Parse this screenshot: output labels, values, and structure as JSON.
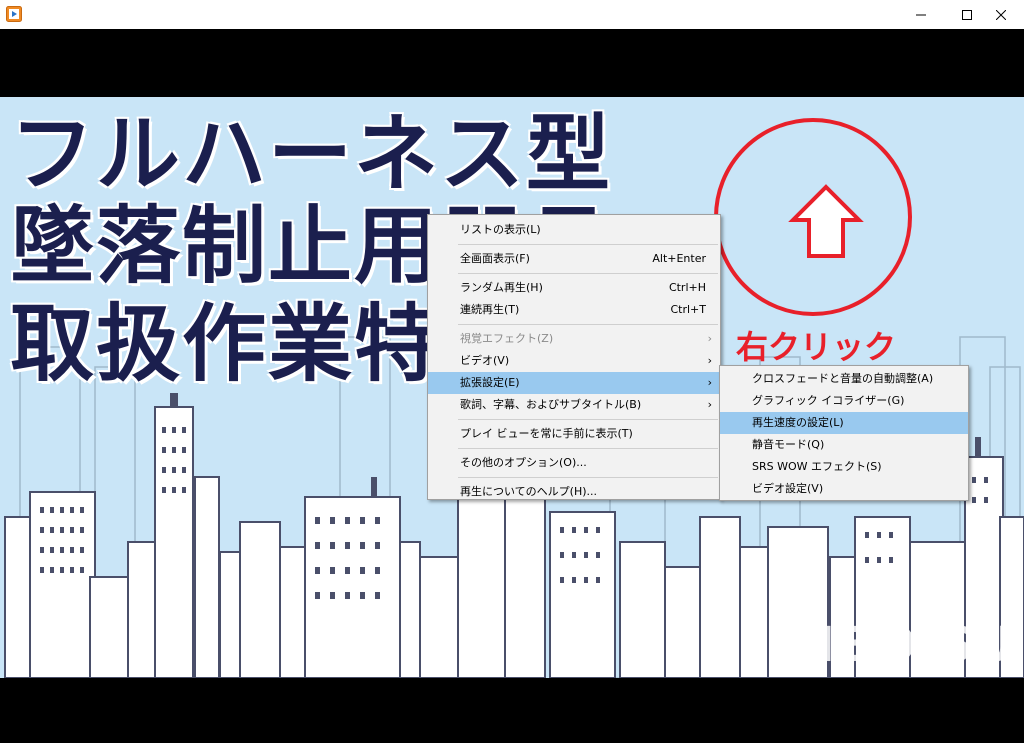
{
  "window": {
    "app_icon": "media-player-icon",
    "controls": {
      "minimize": "minimize-icon",
      "maximize": "maximize-icon",
      "close": "close-icon"
    }
  },
  "video": {
    "headline_lines": [
      "フルハーネス型",
      "墜落制止用器具",
      "取扱作業特"
    ],
    "annotation": "右クリック",
    "watermark": "RIBOISU",
    "annotation_color": "#e8202a",
    "headline_color": "#1b1f4e",
    "background_color": "#c9e5f7"
  },
  "context_menu": {
    "items": [
      {
        "label": "リストの表示(L)"
      },
      {
        "label": "全画面表示(F)",
        "shortcut": "Alt+Enter"
      },
      {
        "label": "ランダム再生(H)",
        "shortcut": "Ctrl+H"
      },
      {
        "label": "連続再生(T)",
        "shortcut": "Ctrl+T"
      },
      {
        "label": "視覚エフェクト(Z)"
      },
      {
        "label": "ビデオ(V)"
      },
      {
        "label": "拡張設定(E)"
      },
      {
        "label": "歌詞、字幕、およびサブタイトル(B)"
      },
      {
        "label": "プレイ ビューを常に手前に表示(T)"
      },
      {
        "label": "その他のオプション(O)..."
      },
      {
        "label": "再生についてのヘルプ(H)..."
      }
    ]
  },
  "submenu": {
    "items": [
      {
        "label": "クロスフェードと音量の自動調整(A)"
      },
      {
        "label": "グラフィック イコライザー(G)"
      },
      {
        "label": "再生速度の設定(L)"
      },
      {
        "label": "静音モード(Q)"
      },
      {
        "label": "SRS WOW エフェクト(S)"
      },
      {
        "label": "ビデオ設定(V)"
      }
    ]
  }
}
